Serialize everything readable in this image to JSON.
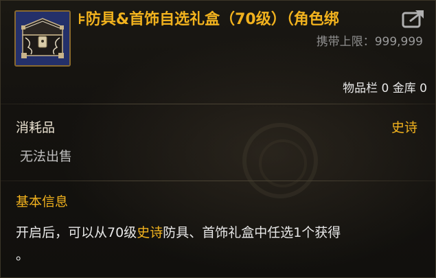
{
  "item": {
    "title": "⊧防具&首饰自选礼盒（70级）（角色绑",
    "icon": "treasure-chest-icon",
    "carry_limit_label": "携带上限：",
    "carry_limit_value": "999,999",
    "storage_text": "物品栏 0 金库 0",
    "category": "消耗品",
    "rarity": "史诗",
    "sell_status": "无法出售"
  },
  "info": {
    "section_title": "基本信息",
    "description_part1": "开启后，可以从70级",
    "description_highlight": "史诗",
    "description_part2": "防具、首饰礼盒中任选1个获得",
    "description_part3": "。"
  },
  "colors": {
    "epic": "#f1b21e",
    "text": "#e8e8e8",
    "muted": "#8f8f8f",
    "background": "#14120f"
  },
  "icons": {
    "share": "share-icon"
  }
}
